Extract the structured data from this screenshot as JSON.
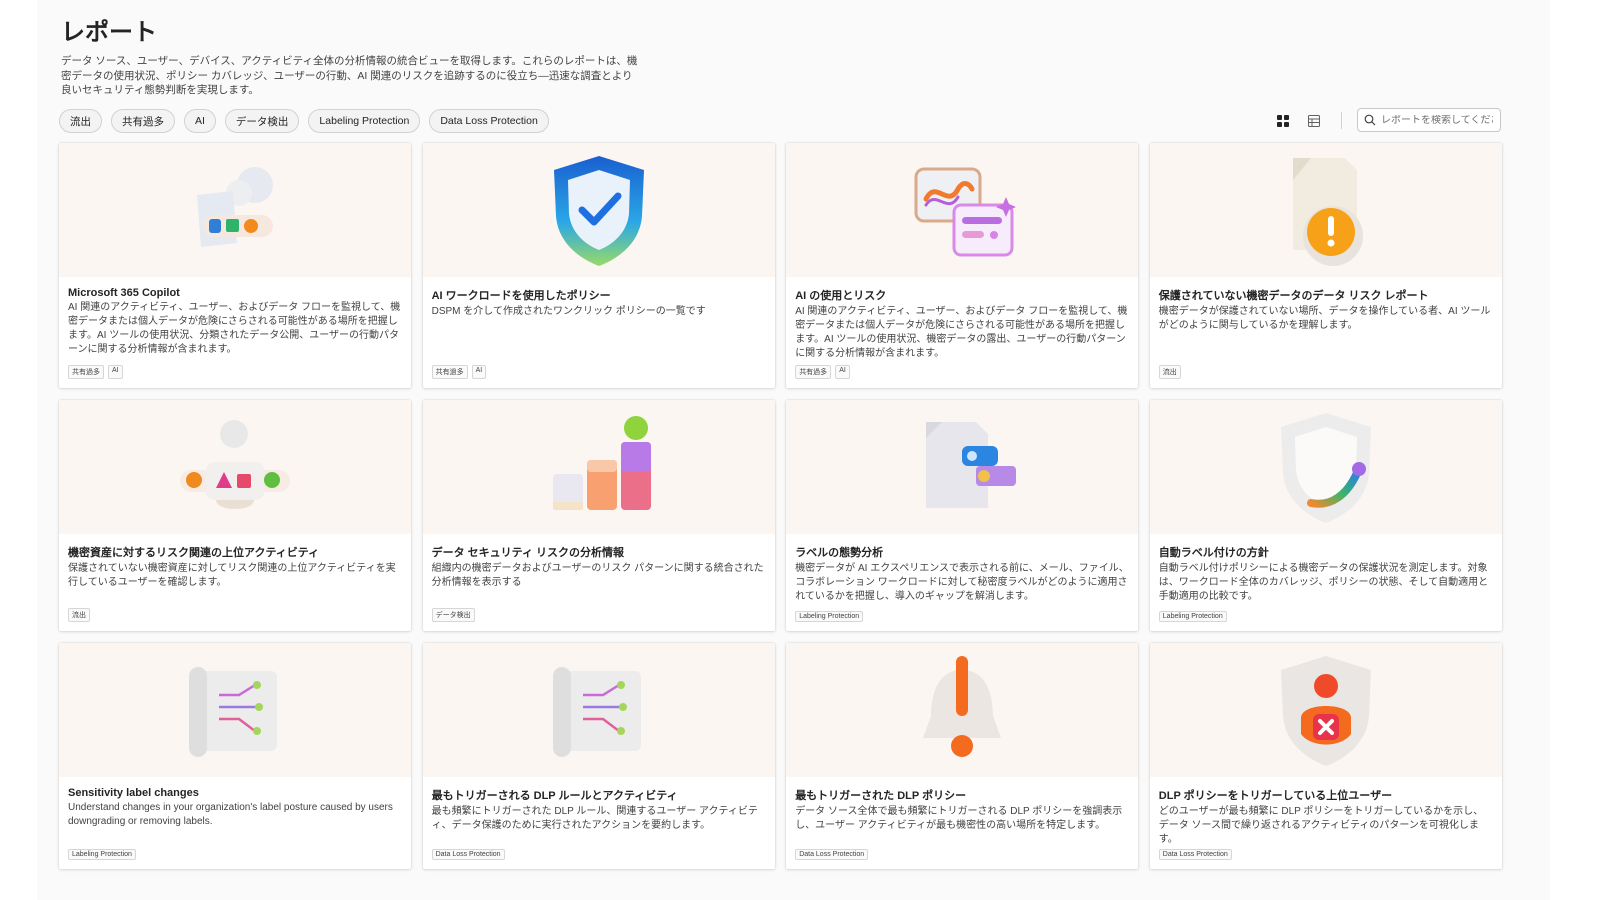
{
  "page": {
    "title": "レポート",
    "description": "データ ソース、ユーザー、デバイス、アクティビティ全体の分析情報の統合ビューを取得します。これらのレポートは、機密データの使用状況、ポリシー カバレッジ、ユーザーの行動、AI 関連のリスクを追跡するのに役立ち—迅速な調査とより良いセキュリティ態勢判断を実現します。"
  },
  "filters": [
    "流出",
    "共有過多",
    "AI",
    "データ検出",
    "Labeling Protection",
    "Data Loss Protection"
  ],
  "toolbar": {
    "grid_view_icon": "grid-view-icon",
    "list_view_icon": "list-view-icon",
    "search_placeholder": "レポートを検索してください"
  },
  "cards": [
    {
      "title": "Microsoft 365 Copilot",
      "desc": "AI 関連のアクティビティ、ユーザー、およびデータ フローを監視して、機密データまたは個人データが危険にさらされる可能性がある場所を把握します。AI ツールの使用状況、分類されたデータ公開、ユーザーの行動パターンに関する分析情報が含まれます。",
      "tags": [
        "共有過多",
        "AI"
      ],
      "icon": "copilot-illustration"
    },
    {
      "title": "AI ワークロードを使用したポリシー",
      "desc": "DSPM を介して作成されたワンクリック ポリシーの一覧です",
      "tags": [
        "共有過多",
        "AI"
      ],
      "icon": "shield-check-illustration"
    },
    {
      "title": "AI の使用とリスク",
      "desc": "AI 関連のアクティビティ、ユーザー、およびデータ フローを監視して、機密データまたは個人データが危険にさらされる可能性がある場所を把握します。AI ツールの使用状況、機密データの露出、ユーザーの行動パターンに関する分析情報が含まれます。",
      "tags": [
        "共有過多",
        "AI"
      ],
      "icon": "ai-usage-illustration"
    },
    {
      "title": "保護されていない機密データのデータ リスク レポート",
      "desc": "機密データが保護されていない場所、データを操作している者、AI ツールがどのように関与しているかを理解します。",
      "tags": [
        "流出"
      ],
      "icon": "document-warning-illustration"
    },
    {
      "title": "機密資産に対するリスク関連の上位アクティビティ",
      "desc": "保護されていない機密資産に対してリスク関連の上位アクティビティを実行しているユーザーを確認します。",
      "tags": [
        "流出"
      ],
      "icon": "user-shapes-illustration"
    },
    {
      "title": "データ セキュリティ リスクの分析情報",
      "desc": "組織内の機密データおよびユーザーのリスク パターンに関する統合された分析情報を表示する",
      "tags": [
        "データ検出"
      ],
      "icon": "bar-chart-illustration"
    },
    {
      "title": "ラベルの態勢分析",
      "desc": "機密データが AI エクスペリエンスで表示される前に、メール、ファイル、コラボレーション ワークロードに対して秘密度ラベルがどのように適用されているかを把握し、導入のギャップを解消します。",
      "tags": [
        "Labeling Protection"
      ],
      "icon": "document-label-illustration"
    },
    {
      "title": "自動ラベル付けの方針",
      "desc": "自動ラベル付けポリシーによる機密データの保護状況を測定します。対象は、ワークロード全体のカバレッジ、ポリシーの状態、そして自動適用と手動適用の比較です。",
      "tags": [
        "Labeling Protection"
      ],
      "icon": "shield-outline-illustration"
    },
    {
      "title": "Sensitivity label changes",
      "desc": "Understand changes in your organization's label posture caused by users downgrading or removing labels.",
      "tags": [
        "Labeling Protection"
      ],
      "icon": "scroll-branches-illustration"
    },
    {
      "title": "最もトリガーされる DLP ルールとアクティビティ",
      "desc": "最も頻繁にトリガーされた DLP ルール、関連するユーザー アクティビティ、データ保護のために実行されたアクションを要約します。",
      "tags": [
        "Data Loss Protection"
      ],
      "icon": "scroll-branches-illustration"
    },
    {
      "title": "最もトリガーされた DLP ポリシー",
      "desc": "データ ソース全体で最も頻繁にトリガーされる DLP ポリシーを強調表示し、ユーザー アクティビティが最も機密性の高い場所を特定します。",
      "tags": [
        "Data Loss Protection"
      ],
      "icon": "bell-alert-illustration"
    },
    {
      "title": "DLP ポリシーをトリガーしている上位ユーザー",
      "desc": "どのユーザーが最も頻繁に DLP ポリシーをトリガーしているかを示し、データ ソース間で繰り返されるアクティビティのパターンを可視化します。",
      "tags": [
        "Data Loss Protection"
      ],
      "icon": "user-shield-x-illustration"
    }
  ]
}
